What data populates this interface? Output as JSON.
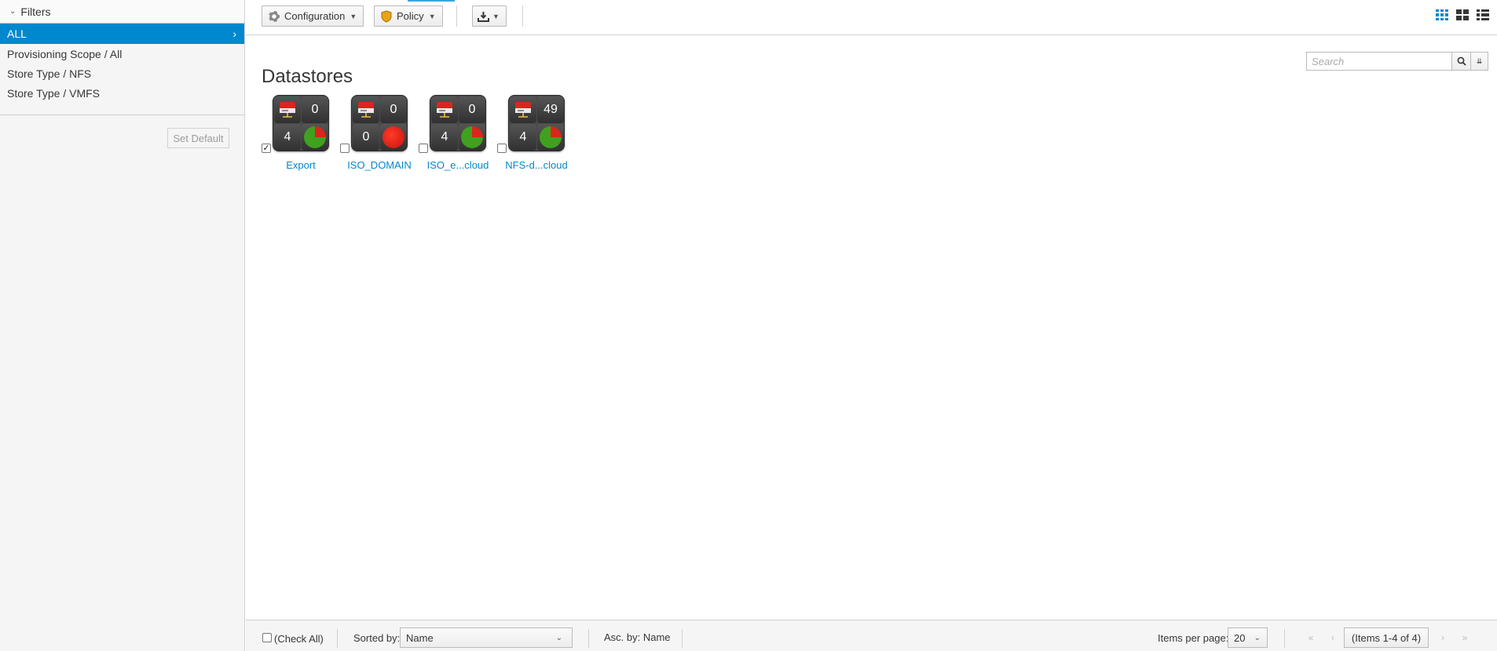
{
  "sidebar": {
    "header": "Filters",
    "items": [
      {
        "label": "ALL",
        "active": true
      },
      {
        "label": "Provisioning Scope / All",
        "active": false
      },
      {
        "label": "Store Type / NFS",
        "active": false
      },
      {
        "label": "Store Type / VMFS",
        "active": false
      }
    ],
    "set_default_label": "Set Default"
  },
  "toolbar": {
    "configuration_label": "Configuration",
    "policy_label": "Policy",
    "download_icon": "download-icon",
    "views": [
      "grid-view-icon",
      "tile-view-icon",
      "list-view-icon"
    ],
    "accent_color": "#0088ce"
  },
  "search": {
    "placeholder": "Search"
  },
  "main": {
    "title": "Datastores",
    "tiles": [
      {
        "name": "Export",
        "top_right": "0",
        "bottom_left": "4",
        "checked": true,
        "pie": "used-free"
      },
      {
        "name": "ISO_DOMAIN",
        "top_right": "0",
        "bottom_left": "0",
        "checked": false,
        "pie": "full-red"
      },
      {
        "name": "ISO_e...cloud",
        "top_right": "0",
        "bottom_left": "4",
        "checked": false,
        "pie": "used-free"
      },
      {
        "name": "NFS-d...cloud",
        "top_right": "49",
        "bottom_left": "4",
        "checked": false,
        "pie": "used-free"
      }
    ]
  },
  "footer": {
    "check_all_label": "(Check All)",
    "sorted_by_label": "Sorted by:",
    "sort_value": "Name",
    "asc_label": "Asc. by: Name",
    "items_per_page_label": "Items per page:",
    "items_per_page_value": "20",
    "items_range": "(Items 1-4 of 4)"
  }
}
